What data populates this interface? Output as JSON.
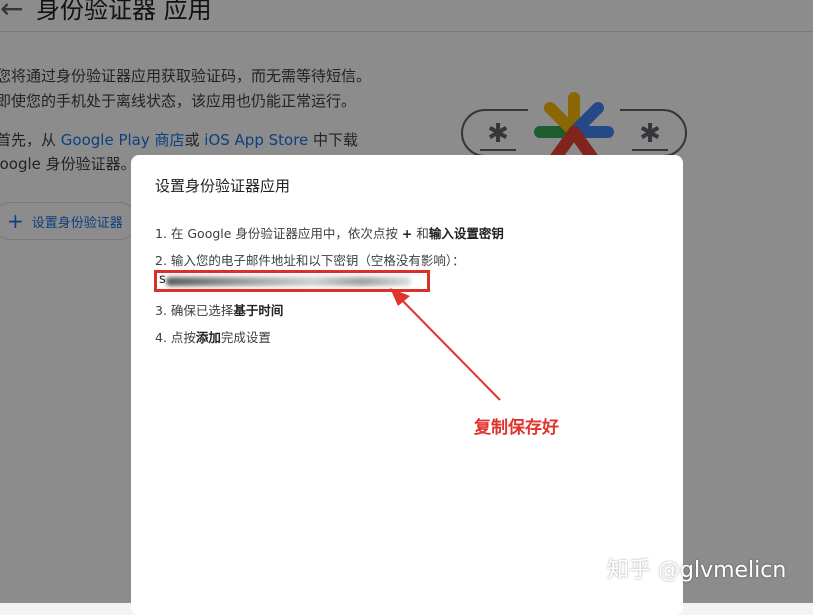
{
  "background": {
    "title": "身份验证器 应用",
    "para1_line1": "您将通过身份验证器应用获取验证码，而无需等待短信。",
    "para1_line2": "即使您的手机处于离线状态，该应用也仍能正常运行。",
    "para2_prefix": "首先，从 ",
    "google_play_link": "Google Play 商店",
    "para2_or": "或 ",
    "app_store_link": "iOS App Store",
    "para2_suffix": " 中下载",
    "para2_line2": "Google 身份验证器。",
    "setup_button_label": "设置身份验证器"
  },
  "dialog": {
    "title": "设置身份验证器应用",
    "step1_prefix": "1. 在 Google 身份验证器应用中，依次点按 ",
    "step1_bold_plus": "+",
    "step1_and": " 和",
    "step1_bold_key": "输入设置密钥",
    "step2": "2. 输入您的电子邮件地址和以下密钥（空格没有影响）：",
    "key_visible_start": "s",
    "step3_prefix": "3. 确保已选择",
    "step3_bold": "基于时间",
    "step4_prefix": "4. 点按",
    "step4_bold": "添加",
    "step4_suffix": "完成设置"
  },
  "annotation": {
    "text": "复制保存好",
    "color": "#e0332d"
  },
  "watermark": "知乎 @glvmelicn",
  "colors": {
    "link": "#1a73e8",
    "highlight_box": "#d9302c"
  }
}
